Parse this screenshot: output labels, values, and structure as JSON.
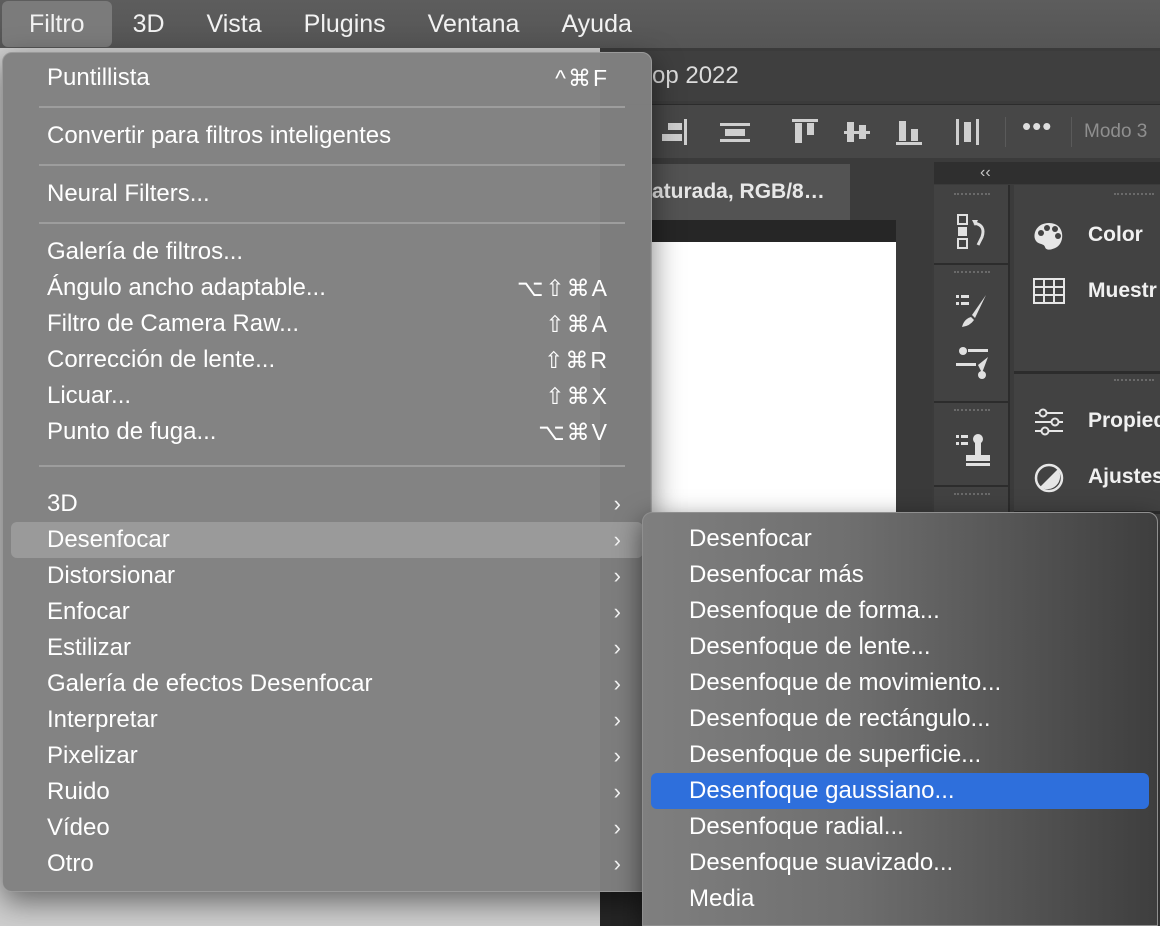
{
  "menubar": {
    "items": [
      "Filtro",
      "3D",
      "Vista",
      "Plugins",
      "Ventana",
      "Ayuda"
    ]
  },
  "window": {
    "title": "op 2022",
    "doc_tab": "aturada, RGB/8…",
    "options_more": "•••",
    "options_mode": "Modo 3",
    "collapse": "‹‹"
  },
  "panels": {
    "items": [
      {
        "label": "Color",
        "icon": "palette-icon"
      },
      {
        "label": "Muestr",
        "icon": "swatches-icon"
      },
      {
        "label": "Propied",
        "icon": "properties-icon"
      },
      {
        "label": "Ajustes",
        "icon": "adjustments-icon"
      }
    ]
  },
  "filter_menu": {
    "items": [
      {
        "label": "Puntillista",
        "shortcut": "^⌘F"
      },
      {
        "label": "Convertir para filtros inteligentes"
      },
      {
        "label": "Neural Filters..."
      },
      {
        "label": "Galería de filtros..."
      },
      {
        "label": "Ángulo ancho adaptable...",
        "shortcut": "⌥⇧⌘A"
      },
      {
        "label": "Filtro de Camera Raw...",
        "shortcut": "⇧⌘A"
      },
      {
        "label": "Corrección de lente...",
        "shortcut": "⇧⌘R"
      },
      {
        "label": "Licuar...",
        "shortcut": "⇧⌘X"
      },
      {
        "label": "Punto de fuga...",
        "shortcut": "⌥⌘V"
      },
      {
        "label": "3D",
        "arrow": "›"
      },
      {
        "label": "Desenfocar",
        "arrow": "›",
        "highlighted": true
      },
      {
        "label": "Distorsionar",
        "arrow": "›"
      },
      {
        "label": "Enfocar",
        "arrow": "›"
      },
      {
        "label": "Estilizar",
        "arrow": "›"
      },
      {
        "label": "Galería de efectos Desenfocar",
        "arrow": "›"
      },
      {
        "label": "Interpretar",
        "arrow": "›"
      },
      {
        "label": "Pixelizar",
        "arrow": "›"
      },
      {
        "label": "Ruido",
        "arrow": "›"
      },
      {
        "label": "Vídeo",
        "arrow": "›"
      },
      {
        "label": "Otro",
        "arrow": "›"
      }
    ]
  },
  "blur_submenu": {
    "items": [
      {
        "label": "Desenfocar"
      },
      {
        "label": "Desenfocar más"
      },
      {
        "label": "Desenfoque de forma..."
      },
      {
        "label": "Desenfoque de lente..."
      },
      {
        "label": "Desenfoque de movimiento..."
      },
      {
        "label": "Desenfoque de rectángulo..."
      },
      {
        "label": "Desenfoque de superficie..."
      },
      {
        "label": "Desenfoque gaussiano...",
        "selected": true
      },
      {
        "label": "Desenfoque radial..."
      },
      {
        "label": "Desenfoque suavizado..."
      },
      {
        "label": "Media"
      }
    ]
  },
  "colors": {
    "menu_bg": "#808080",
    "highlight": "#9a9a9a",
    "selection_blue": "#2e6fdc"
  }
}
